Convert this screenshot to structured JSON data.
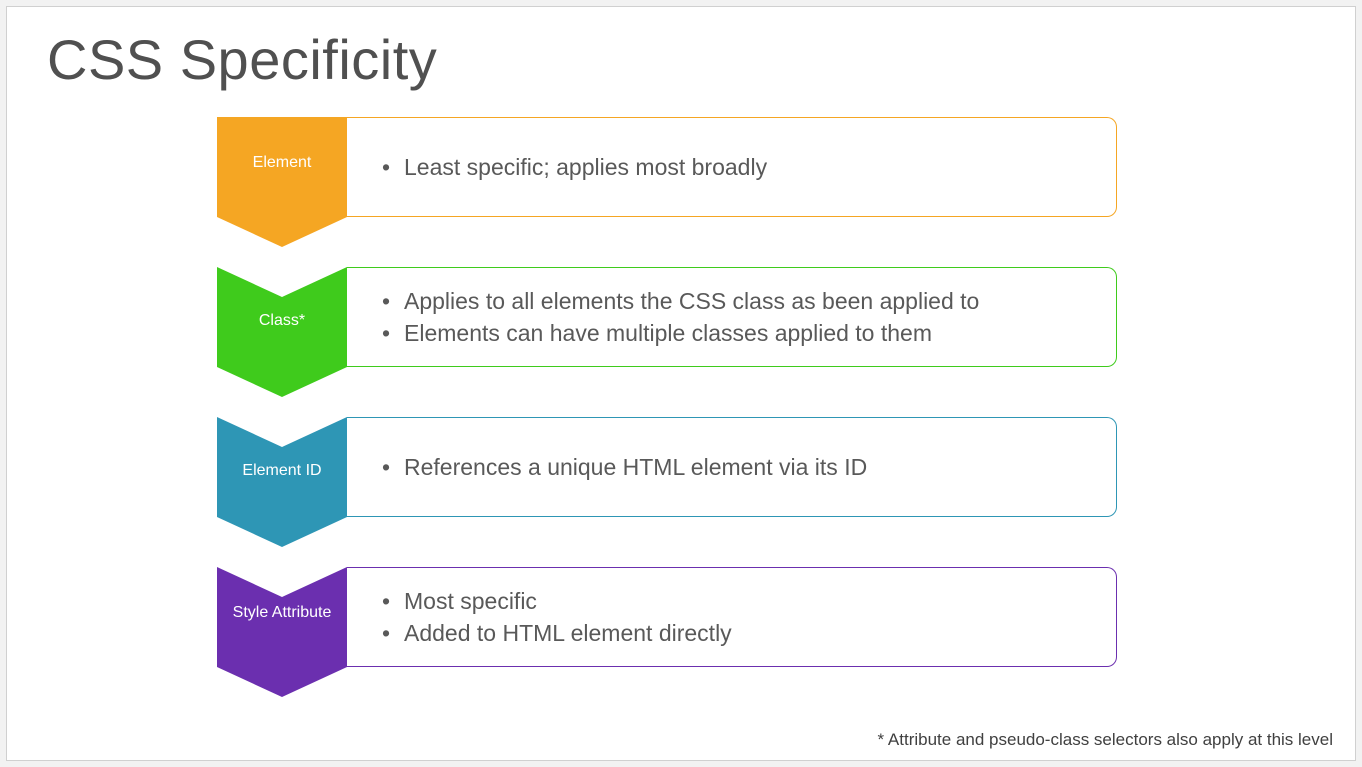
{
  "title": "CSS Specificity",
  "rows": [
    {
      "label": "Element",
      "color": "#F5A623",
      "border": "#F5A623",
      "bullets": [
        "Least specific; applies most broadly"
      ]
    },
    {
      "label": "Class*",
      "color": "#3FCB1C",
      "border": "#3FCB1C",
      "bullets": [
        "Applies to all elements the CSS class as been applied to",
        "Elements can have multiple classes applied to them"
      ]
    },
    {
      "label": "Element ID",
      "color": "#2E96B5",
      "border": "#2E96B5",
      "bullets": [
        "References a unique HTML element via its ID"
      ]
    },
    {
      "label": "Style Attribute",
      "color": "#6B2FAF",
      "border": "#6B2FAF",
      "bullets": [
        "Most specific",
        "Added to HTML element directly"
      ]
    }
  ],
  "footnote": "* Attribute and pseudo-class selectors also apply at this level"
}
